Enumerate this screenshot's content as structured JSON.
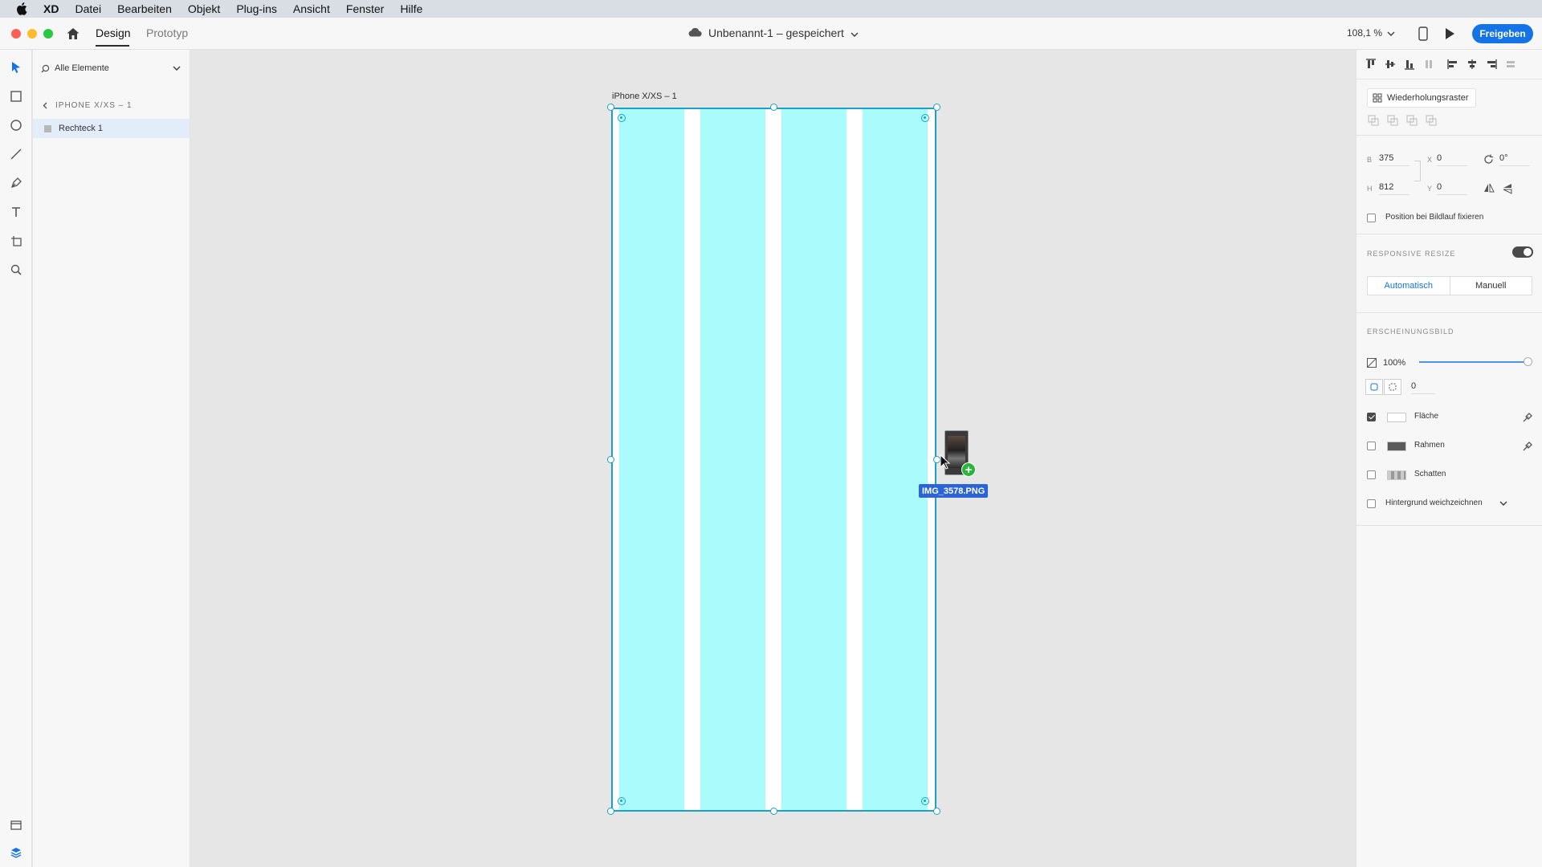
{
  "menubar": {
    "app": "XD",
    "items": [
      "Datei",
      "Bearbeiten",
      "Objekt",
      "Plug-ins",
      "Ansicht",
      "Fenster",
      "Hilfe"
    ]
  },
  "titlebar": {
    "tab_design": "Design",
    "tab_prototyp": "Prototyp",
    "document_title": "Unbenannt-1 – gespeichert",
    "zoom": "108,1 %",
    "share_label": "Freigeben"
  },
  "layers": {
    "filter_label": "Alle Elemente",
    "breadcrumb": "IPHONE X/XS – 1",
    "items": [
      {
        "label": "Rechteck 1"
      }
    ]
  },
  "canvas": {
    "artboard_label": "iPhone X/XS – 1",
    "drag_file": "IMG_3578.PNG"
  },
  "inspector": {
    "repeat_grid": "Wiederholungsraster",
    "fields": {
      "b_label": "B",
      "b_value": "375",
      "x_label": "X",
      "x_value": "0",
      "rotation": "0°",
      "h_label": "H",
      "h_value": "812",
      "y_label": "Y",
      "y_value": "0"
    },
    "fix_position": "Position bei Bildlauf fixieren",
    "responsive_resize": "RESPONSIVE RESIZE",
    "seg_auto": "Automatisch",
    "seg_manual": "Manuell",
    "appearance": "ERSCHEINUNGSBILD",
    "opacity": "100%",
    "opacity_level": 1.0,
    "corner_radius": "0",
    "fill": "Fläche",
    "border": "Rahmen",
    "shadow": "Schatten",
    "blur": "Hintergrund weichzeichnen"
  },
  "colors": {
    "accent": "#1473e6",
    "artboard_border": "#1ba1c4",
    "grid_column": "#a9fcfb"
  }
}
